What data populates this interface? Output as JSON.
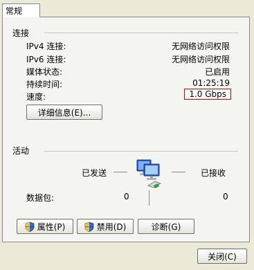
{
  "tabs": [
    {
      "label": "常规"
    }
  ],
  "connection": {
    "title": "连接",
    "rows": [
      {
        "label": "IPv4 连接:",
        "value": "无网络访问权限"
      },
      {
        "label": "IPv6 连接:",
        "value": "无网络访问权限"
      },
      {
        "label": "媒体状态:",
        "value": "已启用"
      },
      {
        "label": "持续时间:",
        "value": "01:25:19"
      },
      {
        "label": "速度:",
        "value": "1.0 Gbps"
      }
    ],
    "details_button": "详细信息(E)..."
  },
  "activity": {
    "title": "活动",
    "sent_label": "已发送",
    "received_label": "已接收",
    "packets_label": "数据包:",
    "packets_sent": "0",
    "packets_received": "0"
  },
  "actions": {
    "properties": "属性(P)",
    "disable": "禁用(D)",
    "diagnose": "诊断(G)"
  },
  "footer": {
    "close": "关闭(C)"
  },
  "colors": {
    "highlight": "#d40000",
    "background": "#ece9d8"
  }
}
